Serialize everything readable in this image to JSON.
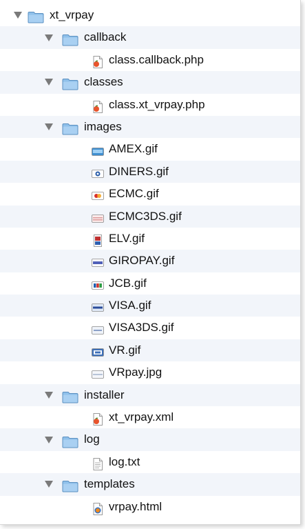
{
  "colors": {
    "alt_row": "#f2f5fa",
    "folder": "#6fa8dc",
    "disclosure": "#7a7a7a"
  },
  "tree": [
    {
      "level": 0,
      "kind": "folder",
      "label": "xt_vrpay",
      "icon": "folder-icon"
    },
    {
      "level": 1,
      "kind": "folder",
      "label": "callback",
      "icon": "folder-icon"
    },
    {
      "level": 2,
      "kind": "file",
      "label": "class.callback.php",
      "icon": "php-file-icon"
    },
    {
      "level": 1,
      "kind": "folder",
      "label": "classes",
      "icon": "folder-icon"
    },
    {
      "level": 2,
      "kind": "file",
      "label": "class.xt_vrpay.php",
      "icon": "php-file-icon"
    },
    {
      "level": 1,
      "kind": "folder",
      "label": "images",
      "icon": "folder-icon"
    },
    {
      "level": 2,
      "kind": "file",
      "label": "AMEX.gif",
      "icon": "amex-card-icon"
    },
    {
      "level": 2,
      "kind": "file",
      "label": "DINERS.gif",
      "icon": "diners-card-icon"
    },
    {
      "level": 2,
      "kind": "file",
      "label": "ECMC.gif",
      "icon": "ecmc-card-icon"
    },
    {
      "level": 2,
      "kind": "file",
      "label": "ECMC3DS.gif",
      "icon": "ecmc3ds-card-icon"
    },
    {
      "level": 2,
      "kind": "file",
      "label": "ELV.gif",
      "icon": "elv-image-icon"
    },
    {
      "level": 2,
      "kind": "file",
      "label": "GIROPAY.gif",
      "icon": "giropay-card-icon"
    },
    {
      "level": 2,
      "kind": "file",
      "label": "JCB.gif",
      "icon": "jcb-card-icon"
    },
    {
      "level": 2,
      "kind": "file",
      "label": "VISA.gif",
      "icon": "visa-card-icon"
    },
    {
      "level": 2,
      "kind": "file",
      "label": "VISA3DS.gif",
      "icon": "visa3ds-card-icon"
    },
    {
      "level": 2,
      "kind": "file",
      "label": "VR.gif",
      "icon": "vr-card-icon"
    },
    {
      "level": 2,
      "kind": "file",
      "label": "VRpay.jpg",
      "icon": "vrpay-image-icon"
    },
    {
      "level": 1,
      "kind": "folder",
      "label": "installer",
      "icon": "folder-icon"
    },
    {
      "level": 2,
      "kind": "file",
      "label": "xt_vrpay.xml",
      "icon": "xml-file-icon"
    },
    {
      "level": 1,
      "kind": "folder",
      "label": "log",
      "icon": "folder-icon"
    },
    {
      "level": 2,
      "kind": "file",
      "label": "log.txt",
      "icon": "text-file-icon"
    },
    {
      "level": 1,
      "kind": "folder",
      "label": "templates",
      "icon": "folder-icon"
    },
    {
      "level": 2,
      "kind": "file",
      "label": "vrpay.html",
      "icon": "html-file-icon"
    }
  ]
}
